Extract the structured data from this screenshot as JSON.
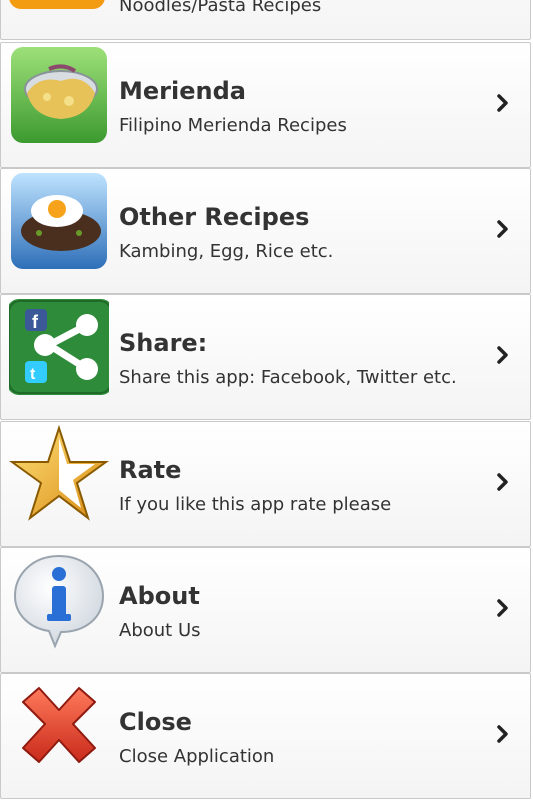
{
  "items": [
    {
      "title": "",
      "subtitle": "Noodles/Pasta Recipes",
      "icon": "noodles-icon"
    },
    {
      "title": "Merienda",
      "subtitle": "Filipino Merienda Recipes",
      "icon": "merienda-icon"
    },
    {
      "title": "Other Recipes",
      "subtitle": "Kambing, Egg, Rice etc.",
      "icon": "egg-rice-icon"
    },
    {
      "title": "Share:",
      "subtitle": "Share this app: Facebook, Twitter etc.",
      "icon": "share-icon"
    },
    {
      "title": "Rate",
      "subtitle": "If you like this app rate please",
      "icon": "star-icon"
    },
    {
      "title": "About",
      "subtitle": "About Us",
      "icon": "info-icon"
    },
    {
      "title": "Close",
      "subtitle": "Close Application",
      "icon": "close-icon"
    }
  ],
  "colors": {
    "accent_orange": "#f39c12",
    "share_green": "#2e8b3a",
    "facebook_blue": "#3b5998",
    "twitter_blue": "#33ccff",
    "info_blue": "#2a6fd6",
    "close_red": "#e03a2a",
    "star_gold": "#f2b01e"
  }
}
